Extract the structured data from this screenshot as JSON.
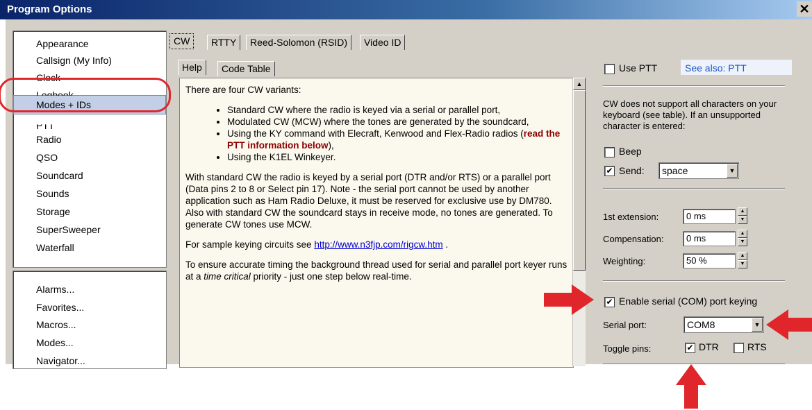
{
  "window": {
    "title": "Program Options",
    "close_glyph": "✕"
  },
  "sidebar": {
    "items": [
      "Appearance",
      "Callsign (My Info)",
      "Clock",
      "Logbook",
      "Modes + IDs",
      "PTT",
      "Radio",
      "QSO",
      "Soundcard",
      "Sounds",
      "Storage",
      "SuperSweeper",
      "Waterfall"
    ],
    "extra_items": [
      "Alarms...",
      "Favorites...",
      "Macros...",
      "Modes...",
      "Navigator..."
    ]
  },
  "tabs": {
    "top": [
      "CW",
      "RTTY",
      "Reed-Solomon (RSID)",
      "Video ID"
    ],
    "sub": [
      "Help",
      "Code Table"
    ]
  },
  "help": {
    "intro": "There are four CW variants:",
    "bullets": [
      "Standard CW where the radio is keyed via a serial or parallel port,",
      "Modulated CW (MCW) where the tones are generated by the soundcard,",
      "Using the K1EL Winkeyer."
    ],
    "ky_prefix": "Using the KY command with Elecraft, Kenwood and Flex-Radio radios (",
    "ky_link": "read the PTT information below",
    "ky_suffix": "),",
    "para1": "With standard CW the radio is keyed by a serial port (DTR and/or RTS) or a parallel port (Data pins 2 to 8 or Select pin 17). Note - the serial port cannot be used by another application such as Ham Radio Deluxe, it must be reserved for exclusive use by DM780. Also with standard CW the soundcard stays in receive mode, no tones are generated. To generate CW tones use MCW.",
    "para2_prefix": "For sample keying circuits see ",
    "para2_link": "http://www.n3fjp.com/rigcw.htm",
    "para2_suffix": " .",
    "para3_a": "To ensure accurate timing the background thread used for serial and parallel port keyer runs at a ",
    "para3_em": "time critical",
    "para3_b": " priority - just one step below real-time."
  },
  "settings": {
    "use_ptt_label": "Use PTT",
    "see_also": "See also: PTT",
    "unsupported_note": "CW does not support all characters on your keyboard (see table). If an unsupported character is entered:",
    "beep_label": "Beep",
    "send_label": "Send:",
    "send_value": "space",
    "first_ext_label": "1st extension:",
    "first_ext_value": "0 ms",
    "comp_label": "Compensation:",
    "comp_value": "0 ms",
    "weight_label": "Weighting:",
    "weight_value": "50 %",
    "enable_serial_label": "Enable serial (COM) port keying",
    "serial_port_label": "Serial port:",
    "serial_port_value": "COM8",
    "toggle_pins_label": "Toggle pins:",
    "dtr_label": "DTR",
    "rts_label": "RTS",
    "check_mark": "✔"
  },
  "colors": {
    "annotation": "#e0262b",
    "selection": "#c3cfe6",
    "see_also_bg": "#eef3fb",
    "link": "#0000cc"
  }
}
